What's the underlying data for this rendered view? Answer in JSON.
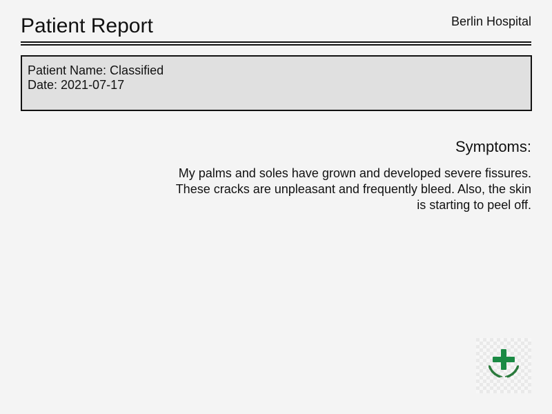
{
  "header": {
    "title": "Patient Report",
    "hospital": "Berlin Hospital"
  },
  "patient": {
    "name_line": "Patient Name: Classified",
    "date_line": "Date: 2021-07-17"
  },
  "symptoms": {
    "heading": "Symptoms:",
    "text": "My palms and soles have grown and developed severe fissures. These cracks are unpleasant and frequently bleed. Also, the skin is starting to peel off."
  },
  "logo": {
    "icon": "medical-cross-laurel-icon",
    "cross_color": "#1a8a44",
    "laurel_color": "#2a7a3c"
  },
  "colors": {
    "background": "#f4f4f4",
    "info_box_fill": "#e0e0e0",
    "text": "#111111"
  }
}
